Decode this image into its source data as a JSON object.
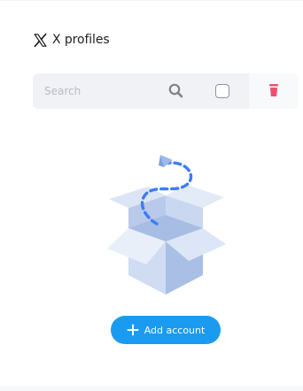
{
  "header": {
    "logo_icon": "x-logo-icon",
    "title": "X profiles"
  },
  "toolbar": {
    "search_placeholder": "Search",
    "search_value": "",
    "search_icon": "search-icon",
    "select_all_checked": false,
    "delete_icon": "trash-icon",
    "delete_color": "#f0506e"
  },
  "empty_state": {
    "illustration": "empty-box-illustration"
  },
  "actions": {
    "add_account_label": "Add account",
    "add_icon": "plus-icon",
    "accent_color": "#1a9bf0"
  }
}
